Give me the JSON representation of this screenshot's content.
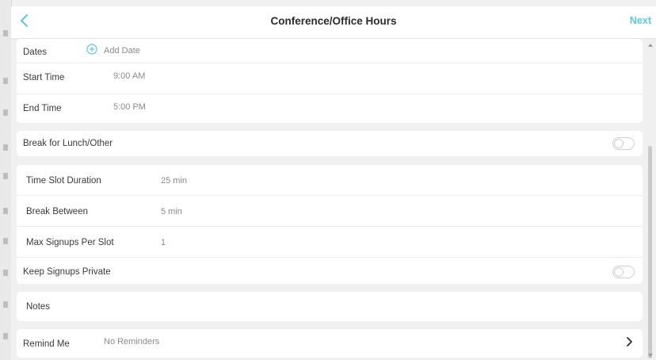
{
  "nav": {
    "title": "Conference/Office Hours",
    "next_label": "Next",
    "accent_color": "#5bc8d8"
  },
  "schedule": {
    "dates_label": "Dates",
    "add_date_label": "Add Date",
    "start_time_label": "Start Time",
    "start_time_value": "9:00 AM",
    "end_time_label": "End Time",
    "end_time_value": "5:00 PM"
  },
  "break_section": {
    "label": "Break for Lunch/Other",
    "enabled": false
  },
  "slots": {
    "duration_label": "Time Slot Duration",
    "duration_value": "25 min",
    "break_between_label": "Break Between",
    "break_between_value": "5 min",
    "max_signups_label": "Max Signups Per Slot",
    "max_signups_value": "1",
    "private_label": "Keep Signups Private",
    "private_enabled": false
  },
  "notes": {
    "label": "Notes"
  },
  "reminder": {
    "label": "Remind Me",
    "value": "No Reminders"
  },
  "icons": {
    "back": "chevron-left-icon",
    "add": "plus-circle-icon",
    "disclosure": "chevron-right-icon"
  }
}
